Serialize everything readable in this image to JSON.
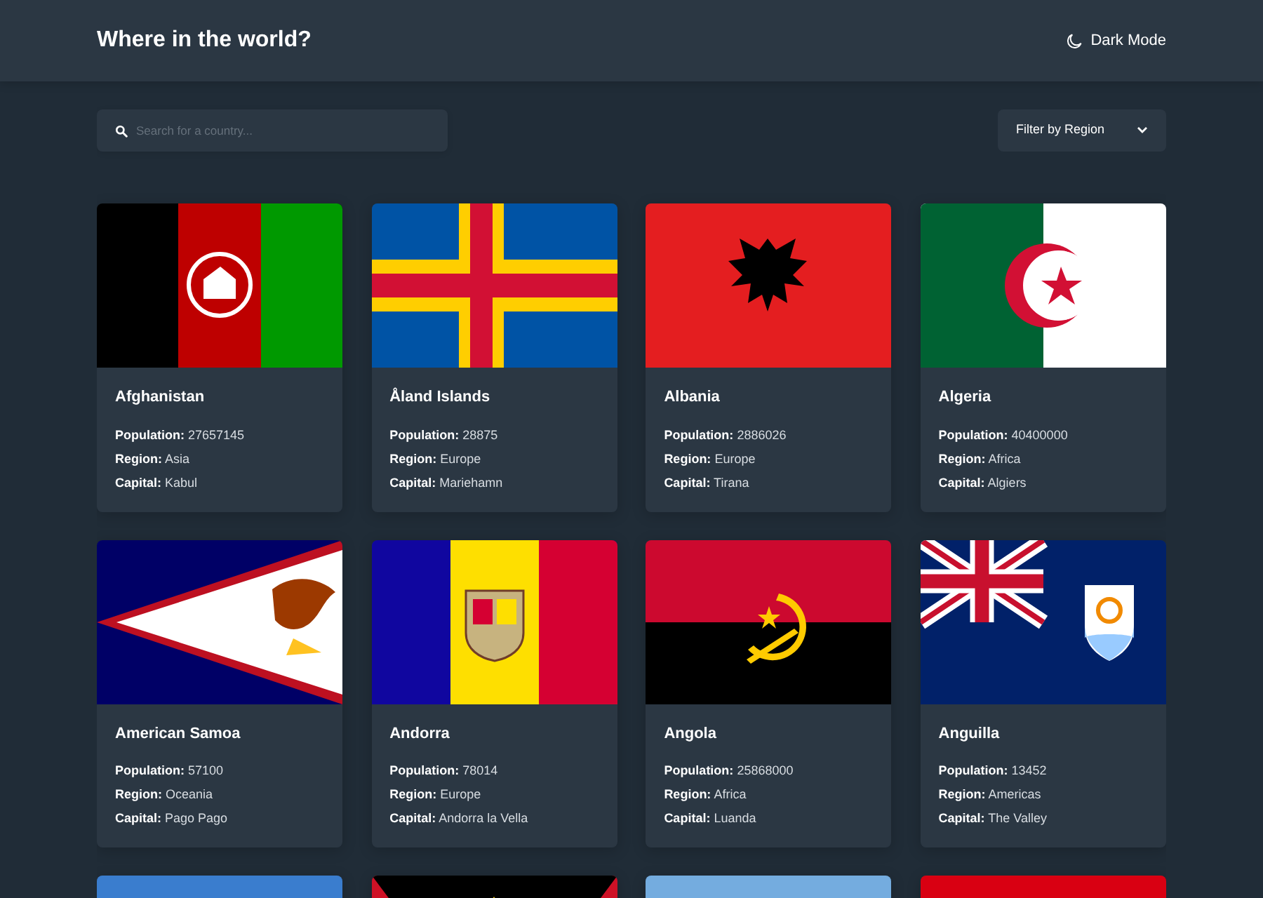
{
  "header": {
    "title": "Where in the world?",
    "theme_toggle": "Dark Mode"
  },
  "search": {
    "placeholder": "Search for a country..."
  },
  "filter": {
    "label": "Filter by Region"
  },
  "countries": [
    {
      "kind": "afghanistan",
      "name": "Afghanistan",
      "details": [
        "**Population:** 27657145",
        "**Region:** Asia",
        "**Capital:** Kabul"
      ]
    },
    {
      "kind": "aland",
      "name": "Åland Islands",
      "details": [
        "**Population:** 28875",
        "**Region:** Europe",
        "**Capital:** Mariehamn"
      ]
    },
    {
      "kind": "albania",
      "name": "Albania",
      "details": [
        "**Population:** 2886026",
        "**Region:** Europe",
        "**Capital:** Tirana"
      ]
    },
    {
      "kind": "algeria",
      "name": "Algeria",
      "details": [
        "**Population:** 40400000",
        "**Region:** Africa",
        "**Capital:** Algiers"
      ]
    },
    {
      "kind": "samoa",
      "name": "American Samoa",
      "details": [
        "**Population:** 57100",
        "**Region:** Oceania",
        "**Capital:** Pago Pago"
      ]
    },
    {
      "kind": "andorra",
      "name": "Andorra",
      "details": [
        "**Population:** 78014",
        "**Region:** Europe",
        "**Capital:** Andorra la Vella"
      ]
    },
    {
      "kind": "angola",
      "name": "Angola",
      "details": [
        "**Population:** 25868000",
        "**Region:** Africa",
        "**Capital:** Luanda"
      ]
    },
    {
      "kind": "anguilla",
      "name": "Anguilla",
      "details": [
        "**Population:** 13452",
        "**Region:** Americas",
        "**Capital:** The Valley"
      ]
    },
    {
      "kind": "antarctica"
    },
    {
      "kind": "antigua"
    },
    {
      "kind": "argentina"
    },
    {
      "kind": "armenia"
    }
  ]
}
